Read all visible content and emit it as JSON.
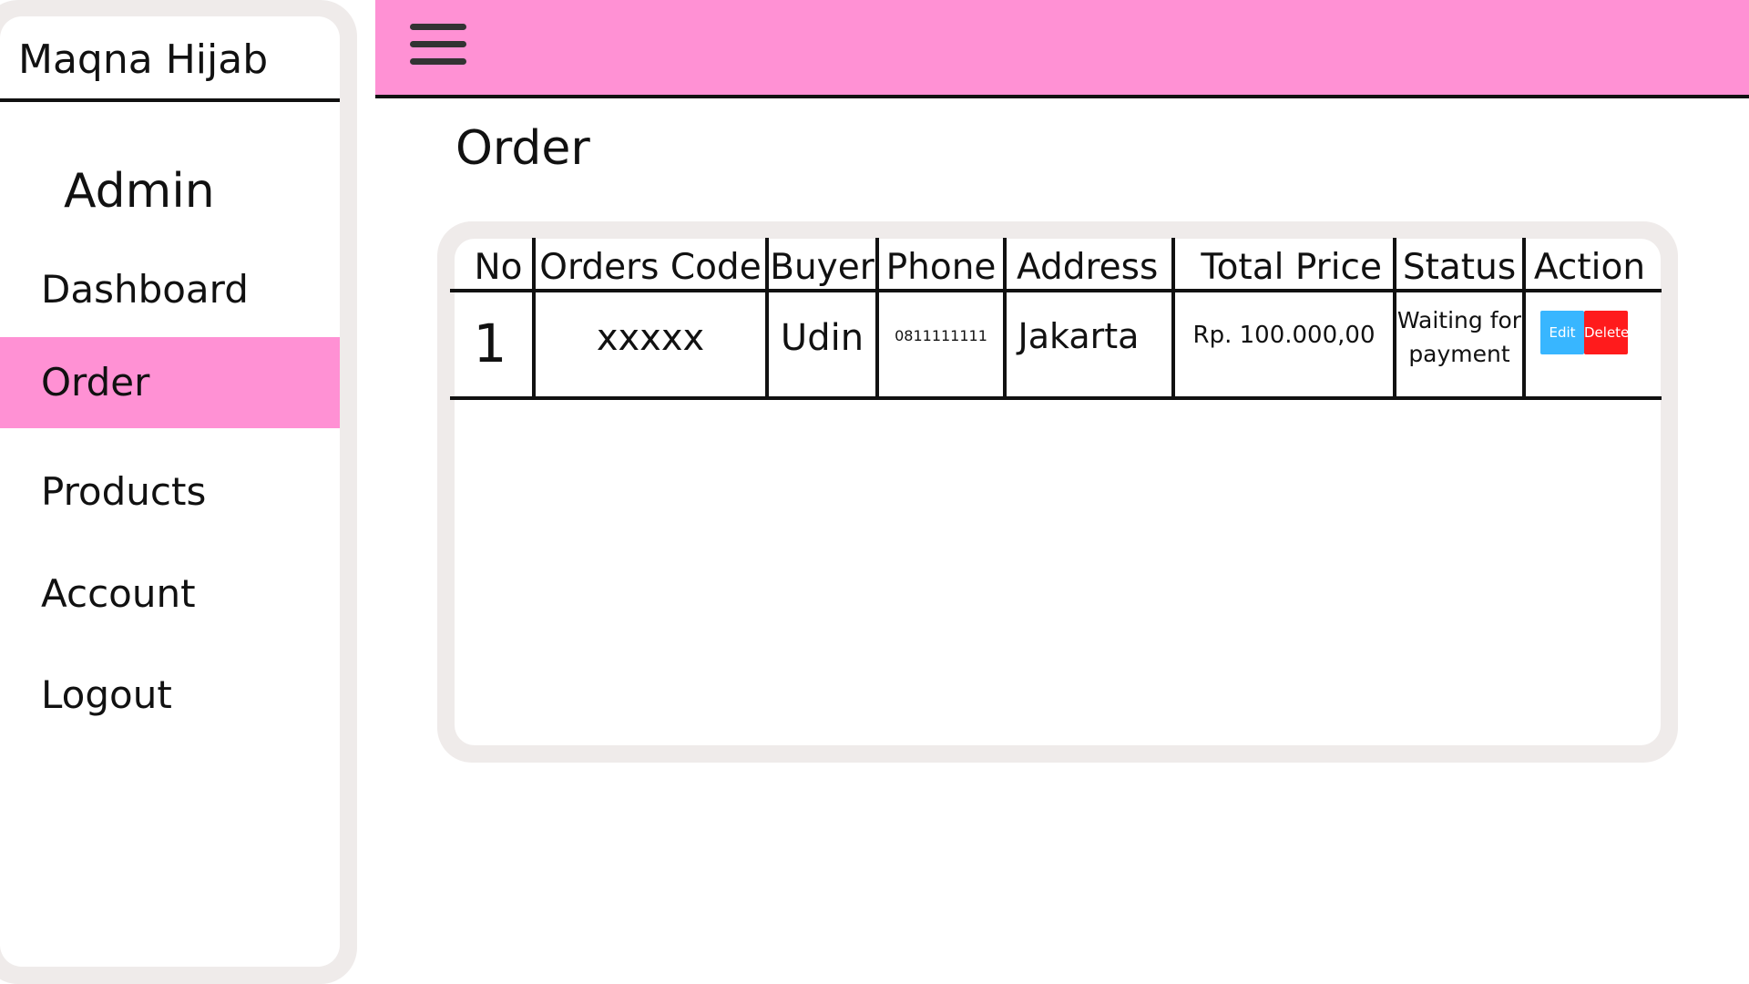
{
  "sidebar": {
    "brand": "Maqna Hijab",
    "role": "Admin",
    "items": [
      {
        "label": "Dashboard",
        "active": false
      },
      {
        "label": "Order",
        "active": true
      },
      {
        "label": "Products",
        "active": false
      },
      {
        "label": "Account",
        "active": false
      },
      {
        "label": "Logout",
        "active": false
      }
    ]
  },
  "header": {
    "menu_icon": "hamburger-menu-icon"
  },
  "main": {
    "title": "Order",
    "table": {
      "columns": [
        "No",
        "Orders Code",
        "Buyer",
        "Phone",
        "Address",
        "Total Price",
        "Status",
        "Action"
      ],
      "rows": [
        {
          "no": "1",
          "orders_code": "xxxxx",
          "buyer": "Udin",
          "phone": "0811111111",
          "address": "Jakarta",
          "total_price": "Rp. 100.000,00",
          "status_line1": "Waiting for",
          "status_line2": "payment",
          "edit_label": "Edit",
          "delete_label": "Delete"
        }
      ]
    }
  },
  "colors": {
    "accent_pink": "#ff91d4",
    "frame_gray": "#efebea",
    "edit_blue": "#38b6ff",
    "delete_red": "#ff1b1c"
  }
}
